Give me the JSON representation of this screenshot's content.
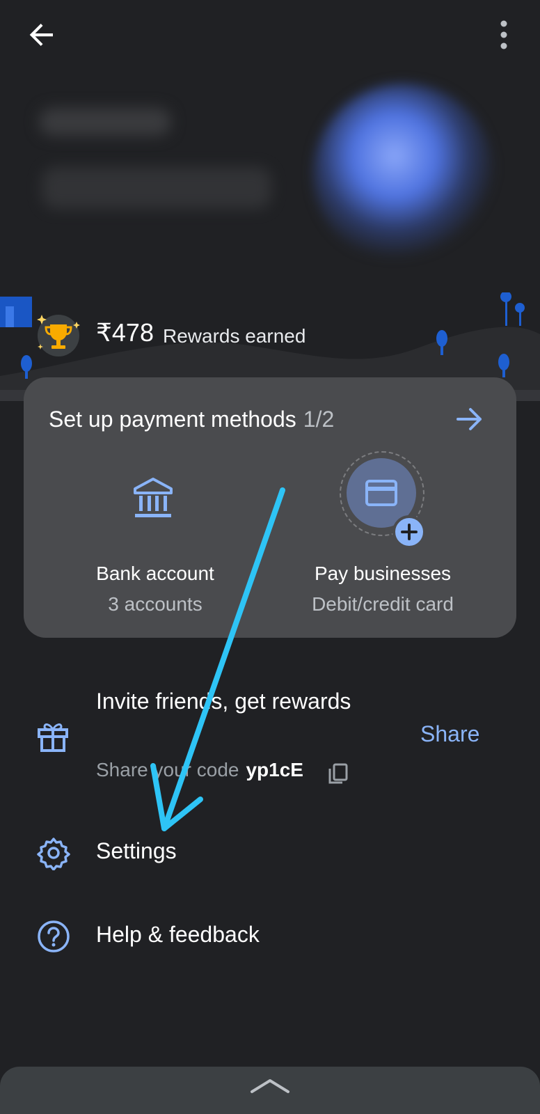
{
  "header": {
    "back_icon": "arrow-left-icon",
    "more_icon": "more-vert-icon"
  },
  "rewards": {
    "amount": "₹478",
    "label": "Rewards earned",
    "icon": "trophy-icon"
  },
  "payment_setup": {
    "title": "Set up payment methods",
    "progress": "1/2",
    "arrow_icon": "arrow-right-icon",
    "items": [
      {
        "title": "Bank account",
        "subtitle": "3 accounts",
        "icon": "bank-icon"
      },
      {
        "title": "Pay businesses",
        "subtitle": "Debit/credit card",
        "icon": "credit-card-add-icon"
      }
    ]
  },
  "invite": {
    "title": "Invite friends, get rewards",
    "subtitle": "Share your code",
    "code": "yp1cE",
    "share_label": "Share",
    "icon": "gift-icon",
    "copy_icon": "copy-icon"
  },
  "menu": [
    {
      "label": "Settings",
      "icon": "settings-gear-icon"
    },
    {
      "label": "Help & feedback",
      "icon": "help-circle-icon"
    }
  ],
  "colors": {
    "background": "#202124",
    "card": "#4a4b4e",
    "accent": "#8ab4f8",
    "annotation_arrow": "#2ec4f6"
  }
}
